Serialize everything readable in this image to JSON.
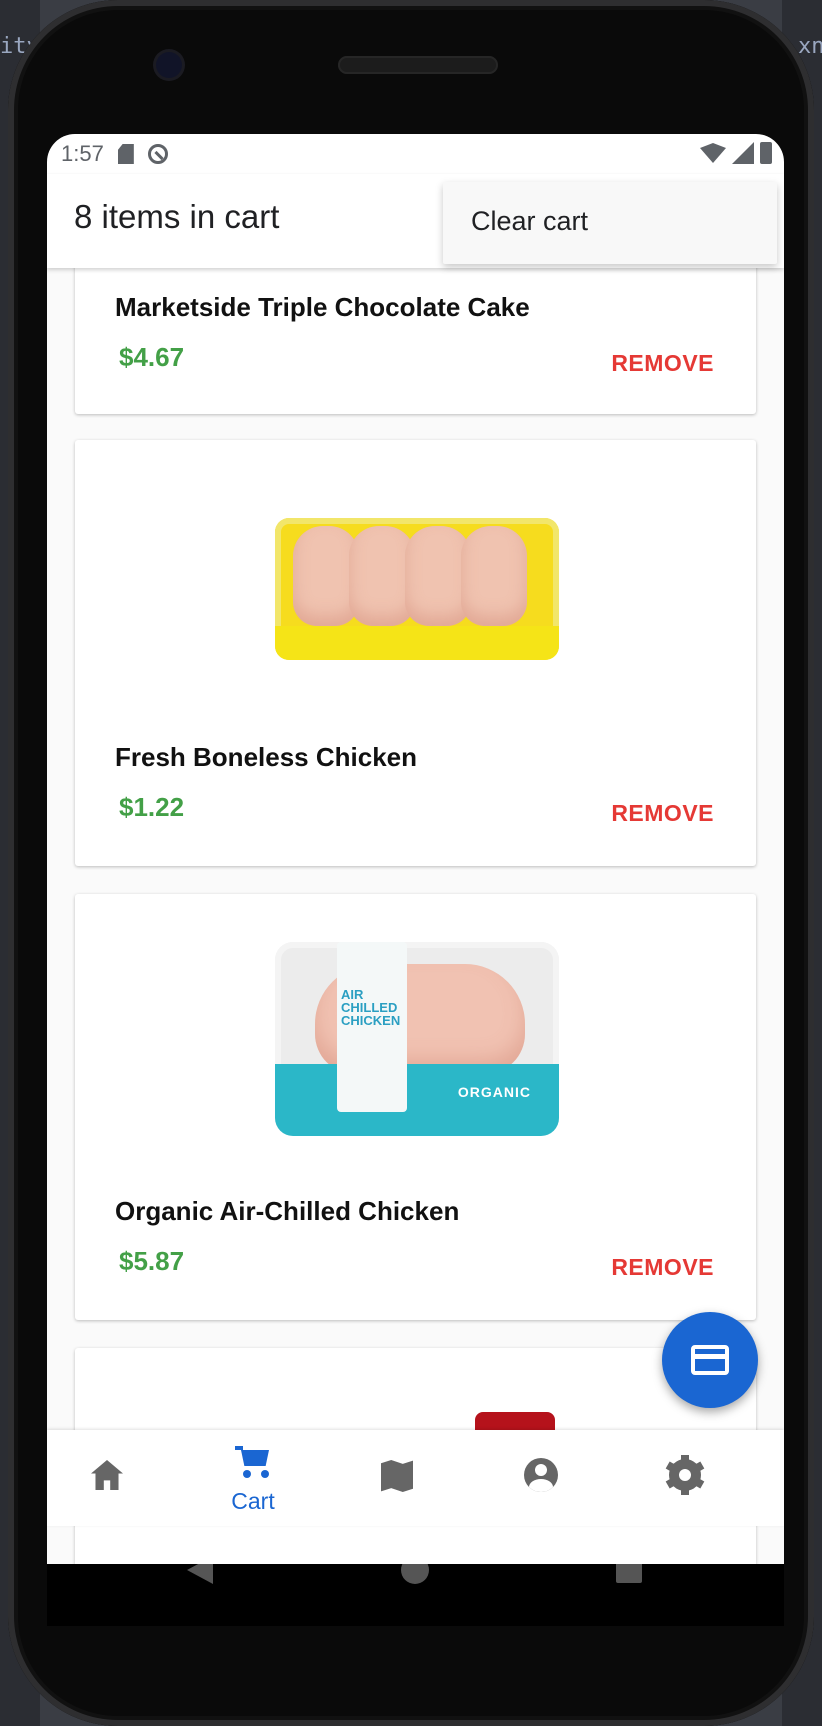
{
  "background": {
    "left_text": "ity",
    "right_text": "xn"
  },
  "status_bar": {
    "time": "1:57"
  },
  "app_bar": {
    "title": "8 items in cart"
  },
  "menu": {
    "items": [
      {
        "label": "Clear cart"
      }
    ]
  },
  "cart_items": [
    {
      "name": "Marketside Triple Chocolate Cake",
      "price": "$4.67",
      "remove_label": "REMOVE"
    },
    {
      "name": "Fresh Boneless Chicken",
      "price": "$1.22",
      "remove_label": "REMOVE"
    },
    {
      "name": "Organic Air-Chilled Chicken",
      "price": "$5.87",
      "remove_label": "REMOVE"
    }
  ],
  "bottom_nav": {
    "items": [
      {
        "icon": "home-icon",
        "label": ""
      },
      {
        "icon": "cart-icon",
        "label": "Cart",
        "active": true
      },
      {
        "icon": "map-icon",
        "label": ""
      },
      {
        "icon": "account-icon",
        "label": ""
      },
      {
        "icon": "settings-icon",
        "label": ""
      }
    ]
  },
  "fab": {
    "icon": "credit-card-icon"
  },
  "colors": {
    "price": "#43a047",
    "remove": "#e53935",
    "accent": "#1a66d2"
  }
}
